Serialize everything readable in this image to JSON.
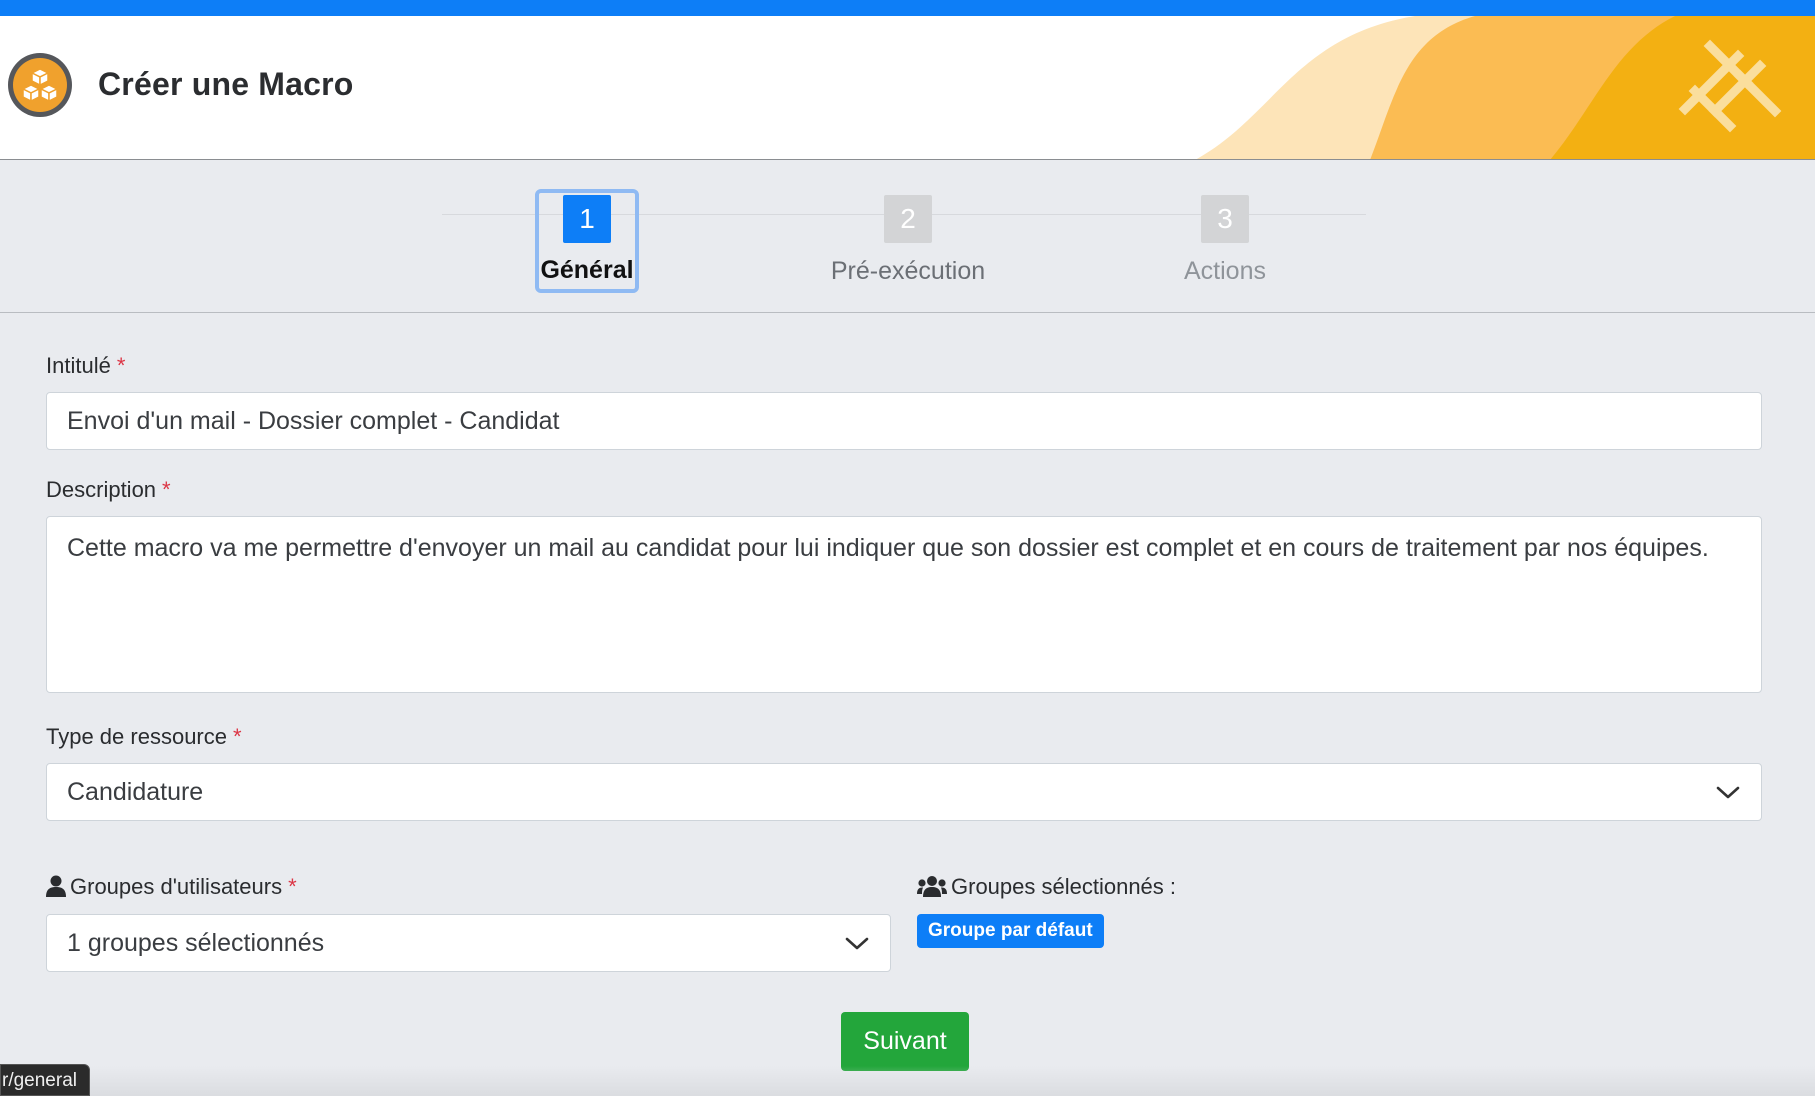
{
  "header": {
    "title": "Créer une Macro",
    "logo_icon": "cubes-icon",
    "brand_mark_icon": "hashtag-logo-icon",
    "accent": "#0d7ef7"
  },
  "stepper": {
    "steps": [
      {
        "number": "1",
        "label": "Général",
        "state": "active"
      },
      {
        "number": "2",
        "label": "Pré-exécution",
        "state": "inactive"
      },
      {
        "number": "3",
        "label": "Actions",
        "state": "inactive"
      }
    ]
  },
  "form": {
    "intitule": {
      "label": "Intitulé",
      "required_mark": "*",
      "value": "Envoi d'un mail - Dossier complet - Candidat"
    },
    "description": {
      "label": "Description",
      "required_mark": "*",
      "value": "Cette macro va me permettre d'envoyer un mail au candidat pour lui indiquer que son dossier est complet et en cours de traitement par nos équipes."
    },
    "type_ressource": {
      "label": "Type de ressource",
      "required_mark": "*",
      "selected": "Candidature"
    },
    "groupes_utilisateurs": {
      "label": "Groupes d'utilisateurs",
      "required_mark": "*",
      "selected": "1 groupes sélectionnés",
      "icon": "user-icon"
    },
    "groupes_selectionnes": {
      "label": "Groupes sélectionnés :",
      "icon": "users-icon",
      "badges": [
        "Groupe par défaut"
      ]
    },
    "next_button": "Suivant",
    "next_button_color": "#23a63b"
  },
  "status_bar": {
    "url_fragment": "r/general"
  }
}
